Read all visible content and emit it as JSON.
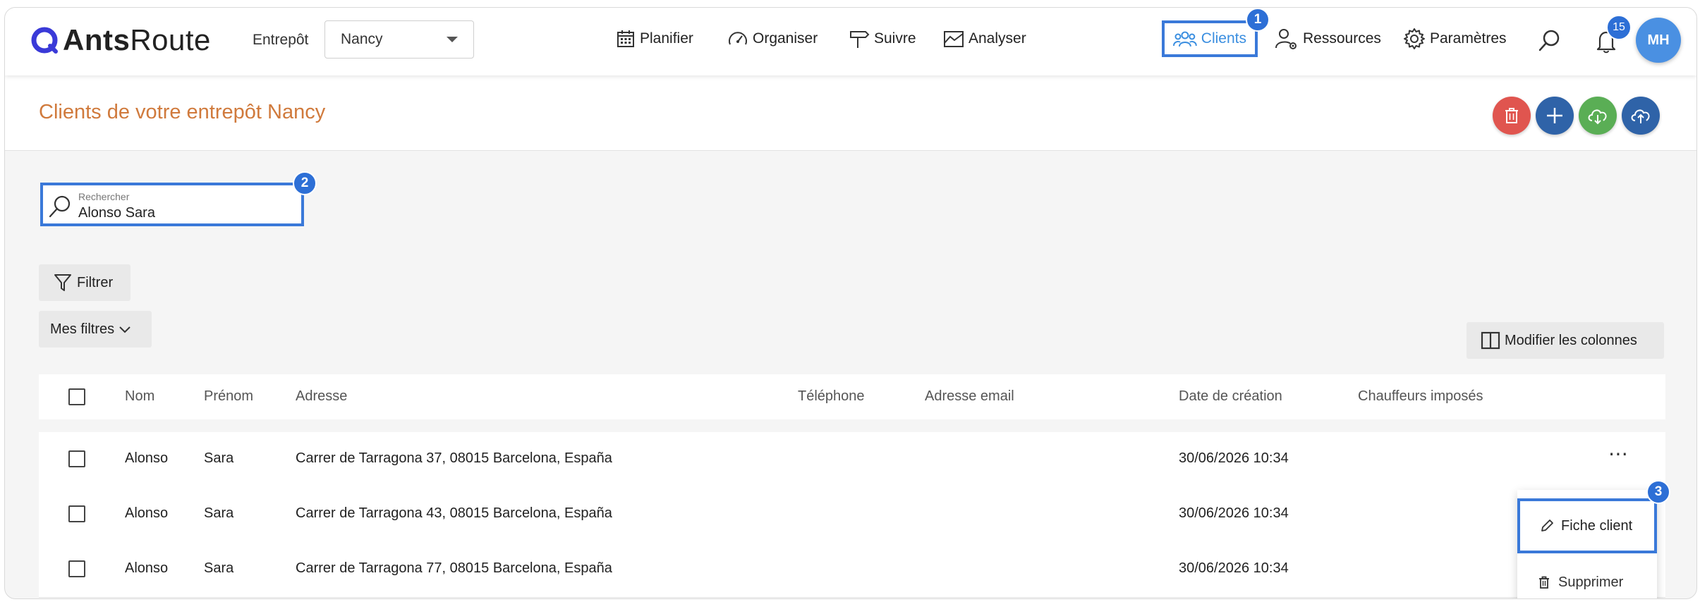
{
  "app": {
    "logo_bold": "Ants",
    "logo_light": "Route"
  },
  "header": {
    "warehouse_label": "Entrepôt",
    "warehouse_value": "Nancy",
    "nav": [
      {
        "label": "Planifier",
        "icon": "calendar-icon"
      },
      {
        "label": "Organiser",
        "icon": "dashboard-gauge-icon"
      },
      {
        "label": "Suivre",
        "icon": "signpost-icon"
      },
      {
        "label": "Analyser",
        "icon": "chart-area-icon"
      },
      {
        "label": "Clients",
        "icon": "users-group-icon",
        "active": true
      },
      {
        "label": "Ressources",
        "icon": "user-gear-icon"
      },
      {
        "label": "Paramètres",
        "icon": "gear-icon"
      }
    ],
    "notification_count": "15",
    "avatar_initials": "MH"
  },
  "markers": [
    "1",
    "2",
    "3"
  ],
  "page": {
    "title": "Clients de votre entrepôt Nancy",
    "actions": [
      {
        "name": "delete",
        "icon": "trash-icon",
        "color": "#e0554f"
      },
      {
        "name": "add",
        "icon": "plus-icon",
        "color": "#2f63a8"
      },
      {
        "name": "import",
        "icon": "cloud-download-icon",
        "color": "#5aae55"
      },
      {
        "name": "export",
        "icon": "cloud-upload-icon",
        "color": "#2f63a8"
      }
    ]
  },
  "search": {
    "placeholder": "Rechercher",
    "value": "Alonso Sara"
  },
  "filters": {
    "filter_label": "Filtrer",
    "my_filters_label": "Mes filtres",
    "columns_label": "Modifier les colonnes"
  },
  "table": {
    "headers": [
      "Nom",
      "Prénom",
      "Adresse",
      "Téléphone",
      "Adresse email",
      "Date de création",
      "Chauffeurs imposés"
    ],
    "rows": [
      {
        "nom": "Alonso",
        "prenom": "Sara",
        "adresse": "Carrer de Tarragona 37, 08015 Barcelona, España",
        "date": "30/06/2026 10:34"
      },
      {
        "nom": "Alonso",
        "prenom": "Sara",
        "adresse": "Carrer de Tarragona 43, 08015 Barcelona, España",
        "date": "30/06/2026 10:34"
      },
      {
        "nom": "Alonso",
        "prenom": "Sara",
        "adresse": "Carrer de Tarragona 77, 08015 Barcelona, España",
        "date": "30/06/2026 10:34"
      }
    ],
    "row_menu_icon": "⋯"
  },
  "row_menu": {
    "edit_label": "Fiche client",
    "delete_label": "Supprimer"
  },
  "colors": {
    "accent": "#3a79d9",
    "title": "#d07a3c",
    "active_nav": "#3a8ee0"
  }
}
